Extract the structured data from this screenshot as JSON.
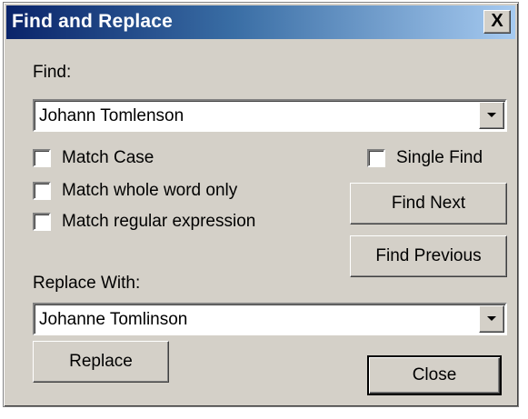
{
  "window": {
    "title": "Find and Replace",
    "close_glyph": "X"
  },
  "find": {
    "label": "Find:",
    "value": "Johann Tomlenson"
  },
  "options": {
    "match_case": "Match Case",
    "match_whole_word": "Match whole word only",
    "match_regex": "Match regular expression",
    "single_find": "Single Find"
  },
  "buttons": {
    "find_next": "Find Next",
    "find_previous": "Find Previous",
    "replace": "Replace",
    "close": "Close"
  },
  "replace": {
    "label": "Replace With:",
    "value": "Johanne Tomlinson"
  },
  "icons": {
    "dropdown": "chevron-down-icon",
    "close": "close-icon"
  }
}
